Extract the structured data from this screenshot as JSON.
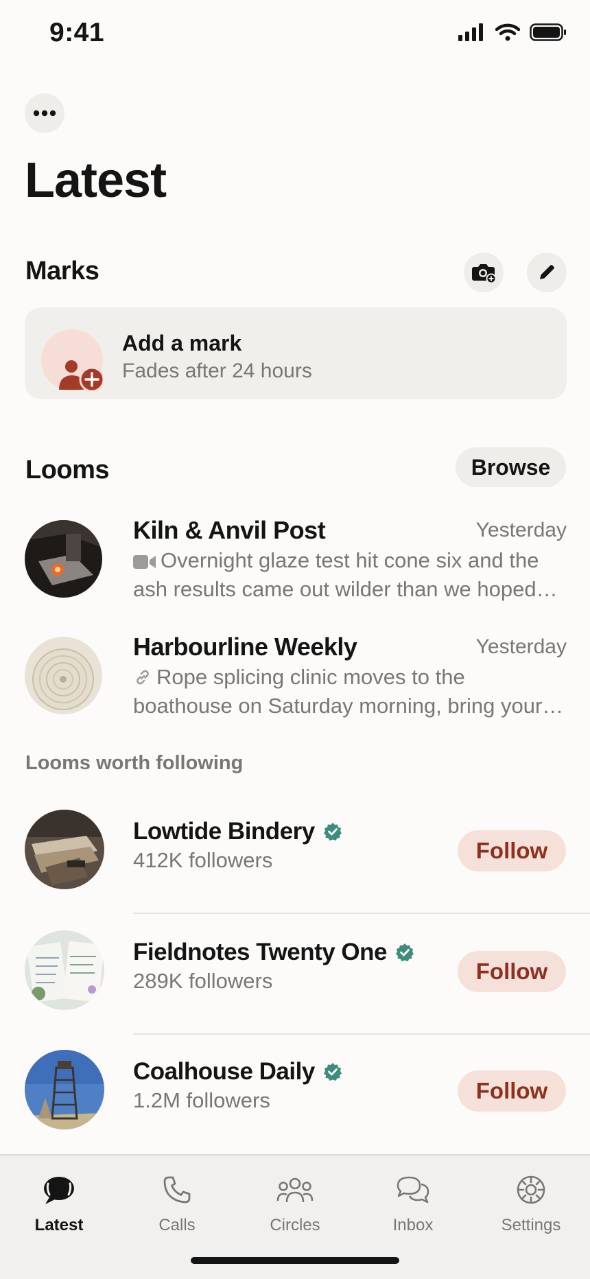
{
  "status_bar": {
    "time": "9:41"
  },
  "header": {
    "title": "Latest",
    "more_icon": "ellipsis-icon"
  },
  "marks": {
    "title": "Marks",
    "card": {
      "title": "Add a mark",
      "subtitle": "Fades after 24 hours"
    }
  },
  "looms": {
    "title": "Looms",
    "browse_label": "Browse",
    "items": [
      {
        "name": "Kiln & Anvil Post",
        "time": "Yesterday",
        "preview_icon": "video-icon",
        "preview": "Overnight glaze test hit cone six and the ash results came out wilder than we hoped and we cannot wait to share"
      },
      {
        "name": "Harbourline Weekly",
        "time": "Yesterday",
        "preview_icon": "link-icon",
        "preview": "Rope splicing clinic moves to the boathouse on Saturday morning, bring your own marlinspike and gloves"
      }
    ]
  },
  "suggestions": {
    "title": "Looms worth following",
    "follow_label": "Follow",
    "items": [
      {
        "name": "Lowtide Bindery",
        "followers": "412K followers"
      },
      {
        "name": "Fieldnotes Twenty One",
        "followers": "289K followers"
      },
      {
        "name": "Coalhouse Daily",
        "followers": "1.2M followers"
      }
    ]
  },
  "tabs": [
    {
      "label": "Latest",
      "icon": "chat-bubble-icon",
      "active": true
    },
    {
      "label": "Calls",
      "icon": "phone-icon"
    },
    {
      "label": "Circles",
      "icon": "people-icon"
    },
    {
      "label": "Inbox",
      "icon": "double-bubble-icon"
    },
    {
      "label": "Settings",
      "icon": "gear-icon"
    }
  ],
  "colors": {
    "accent": "#8e2f1f",
    "verified": "#3f8c7d",
    "follow_bg": "#f5e1da"
  }
}
